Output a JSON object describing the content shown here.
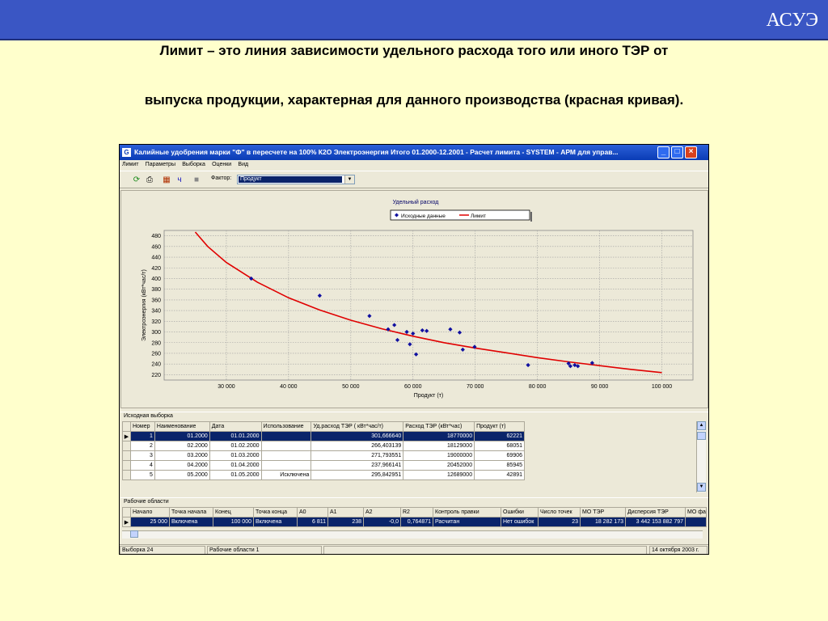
{
  "slide": {
    "brand": "АСУЭ",
    "heading_line1": "Лимит – это линия зависимости удельного расхода того или иного ТЭР от",
    "heading_line2": "выпуска продукции, характерная для данного производства (красная кривая)."
  },
  "window": {
    "title": "Калийные удобрения марки \"Ф\" в пересчете на 100% К2О Электроэнергия Итого 01.2000-12.2001 - Расчет лимита - SYSTEM - АРМ для управ...",
    "menu": [
      "Лимит",
      "Параметры",
      "Выборка",
      "Оценки",
      "Вид"
    ],
    "toolbar": {
      "icons": [
        "refresh-icon",
        "print-icon",
        "table-icon",
        "chart-icon",
        "save-icon"
      ],
      "factor_label": "Фактор:",
      "factor_value": "Продукт"
    }
  },
  "chart_data": {
    "type": "scatter",
    "title": "Удельный расход",
    "xlabel": "Продукт (т)",
    "ylabel": "Электроэнергия (кВт*час/т)",
    "xlim": [
      20000,
      105000
    ],
    "ylim": [
      210,
      490
    ],
    "x_ticks": [
      "30 000",
      "40 000",
      "50 000",
      "60 000",
      "70 000",
      "80 000",
      "90 000",
      "100 000"
    ],
    "x_tick_values": [
      30000,
      40000,
      50000,
      60000,
      70000,
      80000,
      90000,
      100000
    ],
    "y_ticks": [
      220,
      240,
      260,
      280,
      300,
      320,
      340,
      360,
      380,
      400,
      420,
      440,
      460,
      480
    ],
    "grid": true,
    "legend_placement": "top-center",
    "series": [
      {
        "name": "Исходные данные",
        "color": "#1010a0",
        "marker": "diamond",
        "points": [
          [
            34000,
            400
          ],
          [
            45000,
            368
          ],
          [
            53000,
            330
          ],
          [
            56000,
            305
          ],
          [
            57000,
            313
          ],
          [
            57500,
            285
          ],
          [
            59000,
            300
          ],
          [
            59500,
            277
          ],
          [
            60000,
            297
          ],
          [
            60500,
            258
          ],
          [
            61500,
            303
          ],
          [
            62200,
            302
          ],
          [
            66000,
            305
          ],
          [
            67500,
            299
          ],
          [
            68000,
            267
          ],
          [
            69900,
            272
          ],
          [
            78500,
            238
          ],
          [
            85000,
            241
          ],
          [
            85300,
            236
          ],
          [
            86000,
            238
          ],
          [
            86500,
            236
          ],
          [
            88800,
            242
          ]
        ]
      },
      {
        "name": "Лимит",
        "color": "#e00000",
        "line": true,
        "points": [
          [
            25000,
            487
          ],
          [
            27000,
            460
          ],
          [
            30000,
            430
          ],
          [
            35000,
            393
          ],
          [
            40000,
            364
          ],
          [
            45000,
            341
          ],
          [
            50000,
            322
          ],
          [
            55000,
            306
          ],
          [
            60000,
            292
          ],
          [
            65000,
            280
          ],
          [
            70000,
            270
          ],
          [
            75000,
            261
          ],
          [
            80000,
            252
          ],
          [
            85000,
            244
          ],
          [
            90000,
            237
          ],
          [
            95000,
            230
          ],
          [
            100000,
            224
          ]
        ]
      }
    ]
  },
  "sample": {
    "caption": "Исходная выборка",
    "columns": [
      "Номер",
      "Наименование",
      "Дата",
      "Использование",
      "Уд.расход ТЭР ( кВт*час/т)",
      "Расход ТЭР (кВт*час)",
      "Продукт (т)"
    ],
    "rows": [
      [
        "1",
        "01.2000",
        "01.01.2000",
        "",
        "301,666640",
        "18770000",
        "62221"
      ],
      [
        "2",
        "02.2000",
        "01.02.2000",
        "",
        "266,403139",
        "18129000",
        "68051"
      ],
      [
        "3",
        "03.2000",
        "01.03.2000",
        "",
        "271,793551",
        "19000000",
        "69906"
      ],
      [
        "4",
        "04.2000",
        "01.04.2000",
        "",
        "237,966141",
        "20452000",
        "85945"
      ],
      [
        "5",
        "05.2000",
        "01.05.2000",
        "Исключена",
        "295,842951",
        "12689000",
        "42891"
      ]
    ],
    "selected_row": 0
  },
  "areas": {
    "caption": "Рабочие области",
    "columns": [
      "Начало",
      "Точка начала",
      "Конец",
      "Точка конца",
      "A0",
      "A1",
      "A2",
      "R2",
      "Контроль правки",
      "Ошибки",
      "Число точек",
      "МО ТЭР",
      "Дисперсия ТЭР",
      "МО фа"
    ],
    "rows": [
      [
        "25 000",
        "Включена",
        "100 000",
        "Включена",
        "6 811",
        "238",
        "-0,0",
        "0,764871",
        "Расчитан",
        "Нет ошибок",
        "23",
        "18 282 173",
        "3 442 153 882 797",
        ""
      ]
    ]
  },
  "status": {
    "sample_count": "Выборка 24",
    "areas_count": "Рабочие области 1",
    "date": "14 октября 2003 г."
  }
}
